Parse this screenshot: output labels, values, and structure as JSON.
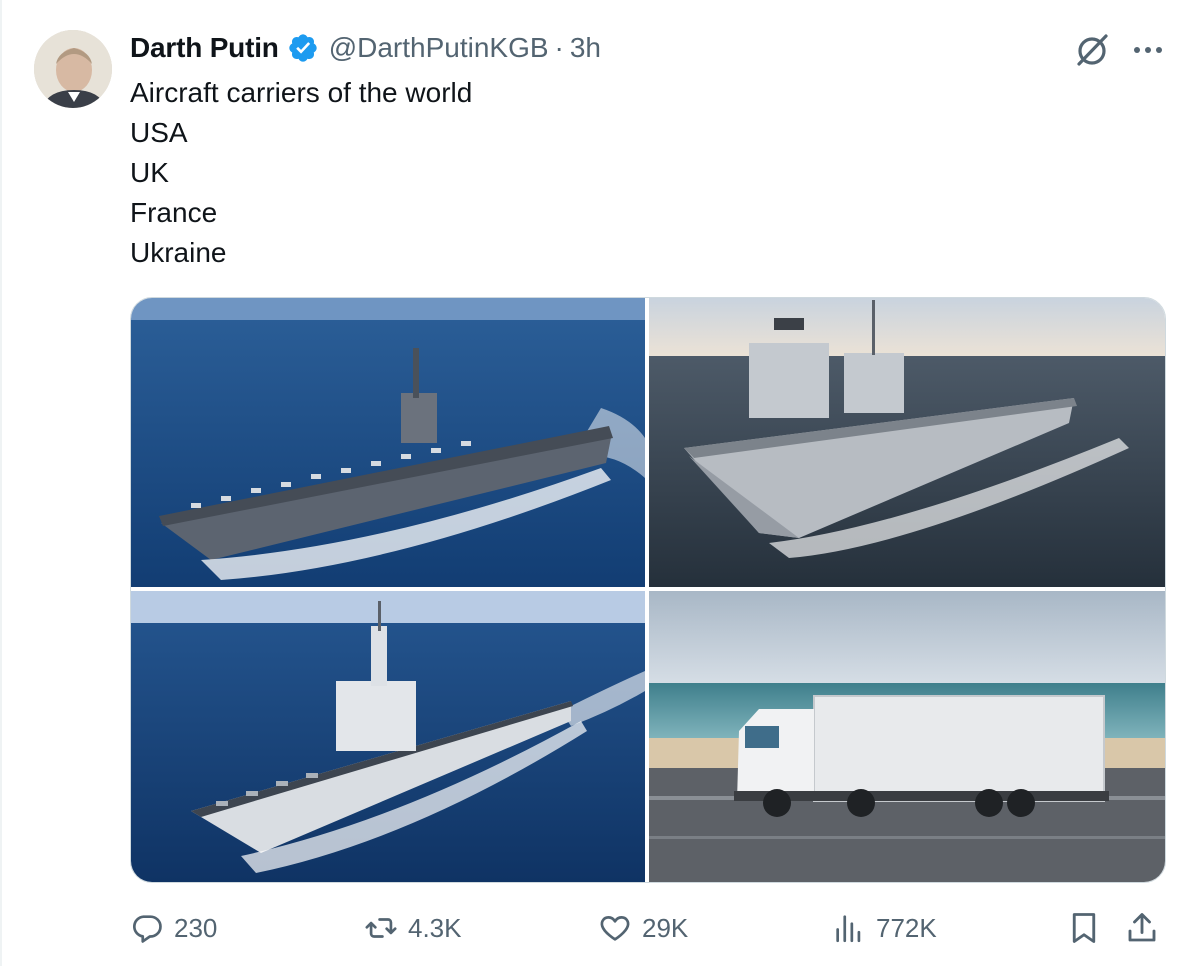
{
  "tweet": {
    "display_name": "Darth Putin",
    "handle": "@DarthPutinKGB",
    "separator": "·",
    "time": "3h",
    "text_lines": [
      "Aircraft carriers of the world",
      "USA",
      "UK",
      "France",
      "Ukraine"
    ]
  },
  "media": [
    {
      "description": "aircraft carrier at sea",
      "icon": "usa-carrier-image"
    },
    {
      "description": "aircraft carrier with two islands",
      "icon": "uk-carrier-image"
    },
    {
      "description": "aircraft carrier sailing",
      "icon": "france-carrier-image"
    },
    {
      "description": "white truck on road by the sea",
      "icon": "truck-image"
    }
  ],
  "actions": {
    "replies": "230",
    "reposts": "4.3K",
    "likes": "29K",
    "views": "772K"
  },
  "icons": {
    "verified": "verified-badge-icon",
    "grok": "grok-icon",
    "more": "more-icon",
    "reply": "reply-icon",
    "repost": "repost-icon",
    "like": "heart-icon",
    "views": "views-icon",
    "bookmark": "bookmark-icon",
    "share": "share-icon"
  },
  "colors": {
    "text": "#0f1419",
    "secondary": "#536471",
    "verified": "#1d9bf0",
    "border": "#cfd9de"
  }
}
